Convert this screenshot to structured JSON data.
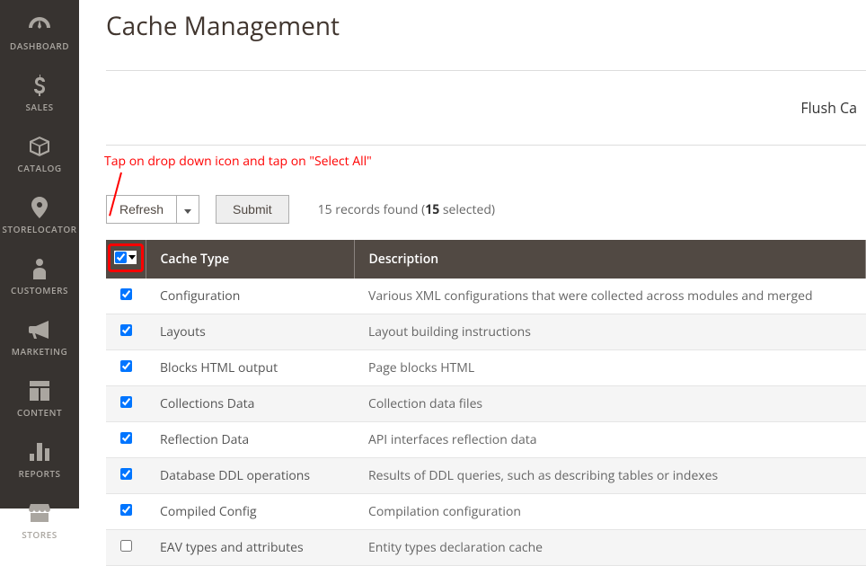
{
  "sidebar": {
    "items": [
      {
        "label": "DASHBOARD",
        "icon": "gauge"
      },
      {
        "label": "SALES",
        "icon": "dollar"
      },
      {
        "label": "CATALOG",
        "icon": "cube"
      },
      {
        "label": "STORELOCATOR",
        "icon": "pin"
      },
      {
        "label": "CUSTOMERS",
        "icon": "person"
      },
      {
        "label": "MARKETING",
        "icon": "megaphone"
      },
      {
        "label": "CONTENT",
        "icon": "layout"
      },
      {
        "label": "REPORTS",
        "icon": "bars"
      },
      {
        "label": "STORES",
        "icon": "storefront"
      }
    ]
  },
  "page": {
    "title": "Cache Management"
  },
  "buttons": {
    "flush": "Flush Ca",
    "refresh": "Refresh",
    "submit": "Submit"
  },
  "records": {
    "prefix": "15 records found (",
    "bold": "15",
    "suffix": " selected)"
  },
  "annotation": {
    "text": "Tap on drop down icon and tap on \"Select All\""
  },
  "columns": {
    "check": "",
    "type": "Cache Type",
    "desc": "Description"
  },
  "rows": [
    {
      "checked": true,
      "type": "Configuration",
      "desc": "Various XML configurations that were collected across modules and merged"
    },
    {
      "checked": true,
      "type": "Layouts",
      "desc": "Layout building instructions"
    },
    {
      "checked": true,
      "type": "Blocks HTML output",
      "desc": "Page blocks HTML"
    },
    {
      "checked": true,
      "type": "Collections Data",
      "desc": "Collection data files"
    },
    {
      "checked": true,
      "type": "Reflection Data",
      "desc": "API interfaces reflection data"
    },
    {
      "checked": true,
      "type": "Database DDL operations",
      "desc": "Results of DDL queries, such as describing tables or indexes"
    },
    {
      "checked": true,
      "type": "Compiled Config",
      "desc": "Compilation configuration"
    },
    {
      "checked": false,
      "type": "EAV types and attributes",
      "desc": "Entity types declaration cache"
    }
  ]
}
